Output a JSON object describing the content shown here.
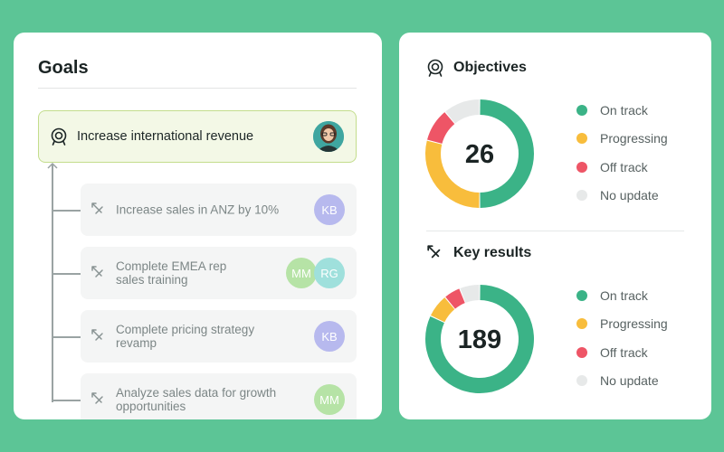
{
  "goals": {
    "title": "Goals",
    "parent": {
      "label": "Increase international revenue",
      "icon": "target-icon"
    },
    "key_results": [
      {
        "label": "Increase sales in ANZ by 10%",
        "avatars": [
          "KB"
        ]
      },
      {
        "label": "Complete EMEA rep\nsales training",
        "avatars": [
          "MM",
          "RG"
        ]
      },
      {
        "label": "Complete pricing strategy\nrevamp",
        "avatars": [
          "KB"
        ]
      },
      {
        "label": "Analyze sales data for growth\nopportunities",
        "avatars": [
          "MM"
        ]
      }
    ]
  },
  "objectives": {
    "title": "Objectives",
    "total": "26",
    "legend": [
      "On track",
      "Progressing",
      "Off track",
      "No update"
    ],
    "segments": [
      {
        "status": "On track",
        "fraction": 0.5
      },
      {
        "status": "Progressing",
        "fraction": 0.29
      },
      {
        "status": "Off track",
        "fraction": 0.1
      },
      {
        "status": "No update",
        "fraction": 0.11
      }
    ]
  },
  "key_results_summary": {
    "title": "Key results",
    "total": "189",
    "legend": [
      "On track",
      "Progressing",
      "Off track",
      "No update"
    ],
    "segments": [
      {
        "status": "On track",
        "fraction": 0.82
      },
      {
        "status": "Progressing",
        "fraction": 0.07
      },
      {
        "status": "Off track",
        "fraction": 0.05
      },
      {
        "status": "No update",
        "fraction": 0.06
      }
    ]
  },
  "colors": {
    "background": "#5cc596",
    "on_track": "#3bb387",
    "progressing": "#f8bd3c",
    "off_track": "#ee5566",
    "no_update": "#e7e9e9",
    "parent_border": "#c3dd8c",
    "parent_fill": "#f3f8e6"
  }
}
